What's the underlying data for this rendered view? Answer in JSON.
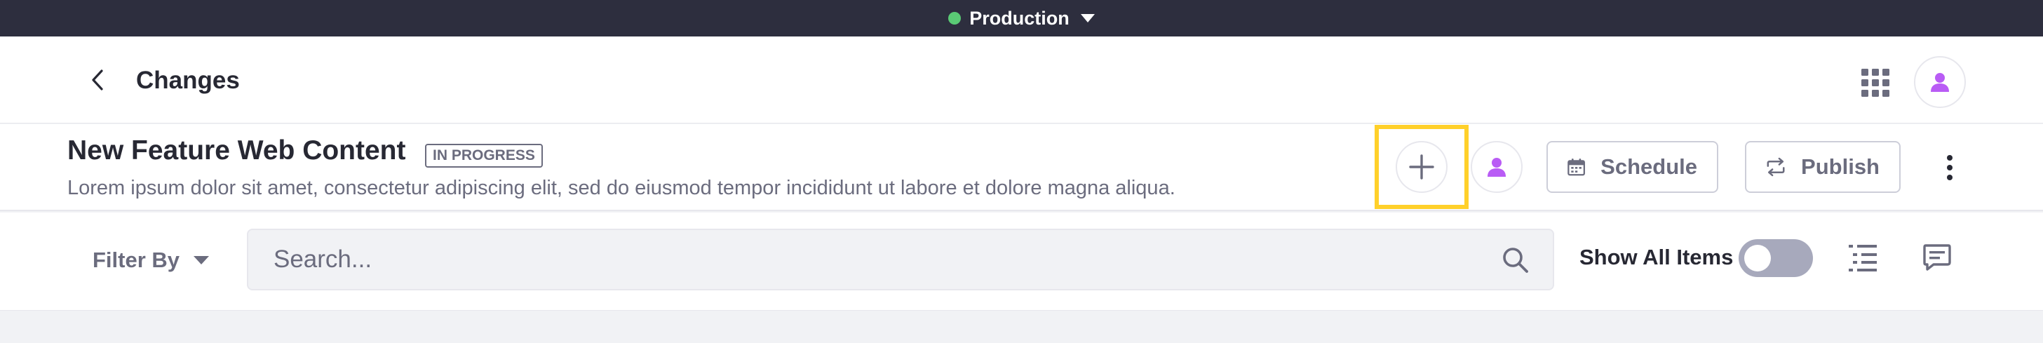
{
  "environment": {
    "label": "Production",
    "status_color": "#5aca75"
  },
  "header": {
    "title": "Changes",
    "back_icon": "chevron-left-icon",
    "apps_icon": "apps-grid-icon",
    "avatar_icon": "user-icon"
  },
  "publication": {
    "name": "New Feature Web Content",
    "status": "IN PROGRESS",
    "description": "Lorem ipsum dolor sit amet, consectetur adipiscing elit, sed do eiusmod tempor incididunt ut labore et dolore magna aliqua.",
    "add_icon": "plus-icon",
    "collaborator_icon": "user-icon",
    "schedule_label": "Schedule",
    "schedule_icon": "calendar-icon",
    "publish_label": "Publish",
    "publish_icon": "arrows-exchange-icon",
    "more_icon": "kebab-menu-icon"
  },
  "toolbar": {
    "filter_label": "Filter By",
    "search_placeholder": "Search...",
    "search_icon": "search-icon",
    "show_all_label": "Show All Items",
    "show_all_on": false,
    "view_icon": "list-view-icon",
    "comments_icon": "comment-icon"
  },
  "colors": {
    "accent": "#b95cf5",
    "highlight": "#ffd02a",
    "topbar": "#2d2e3e"
  }
}
